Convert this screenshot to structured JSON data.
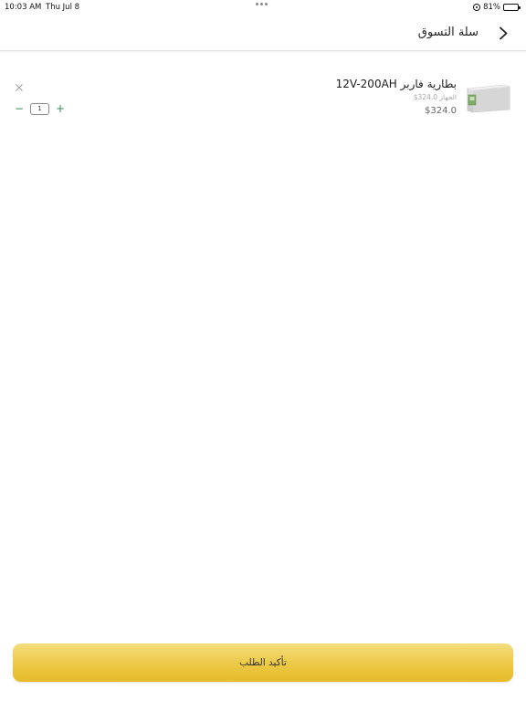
{
  "status_bar": {
    "time": "10:03 AM",
    "date": "Thu Jul 8",
    "battery": "81%",
    "battery_level": 0.81
  },
  "nav": {
    "title": "سلة التسوق",
    "back_icon": "chevron-left-icon"
  },
  "cart": {
    "items": [
      {
        "name": "بطارية فاربر 12V-200AH",
        "subtitle": "الجهاز 324.0$",
        "price": "$324.0",
        "quantity": "1",
        "image_icon": "battery-product-image",
        "minus_label": "−",
        "plus_label": "+"
      }
    ]
  },
  "footer": {
    "confirm_label": "تأكيد الطلب",
    "colors": {
      "button_top": "#f3df7e",
      "button_bottom": "#e7bb2a",
      "stepper_accent": "#3a8a5a"
    }
  }
}
